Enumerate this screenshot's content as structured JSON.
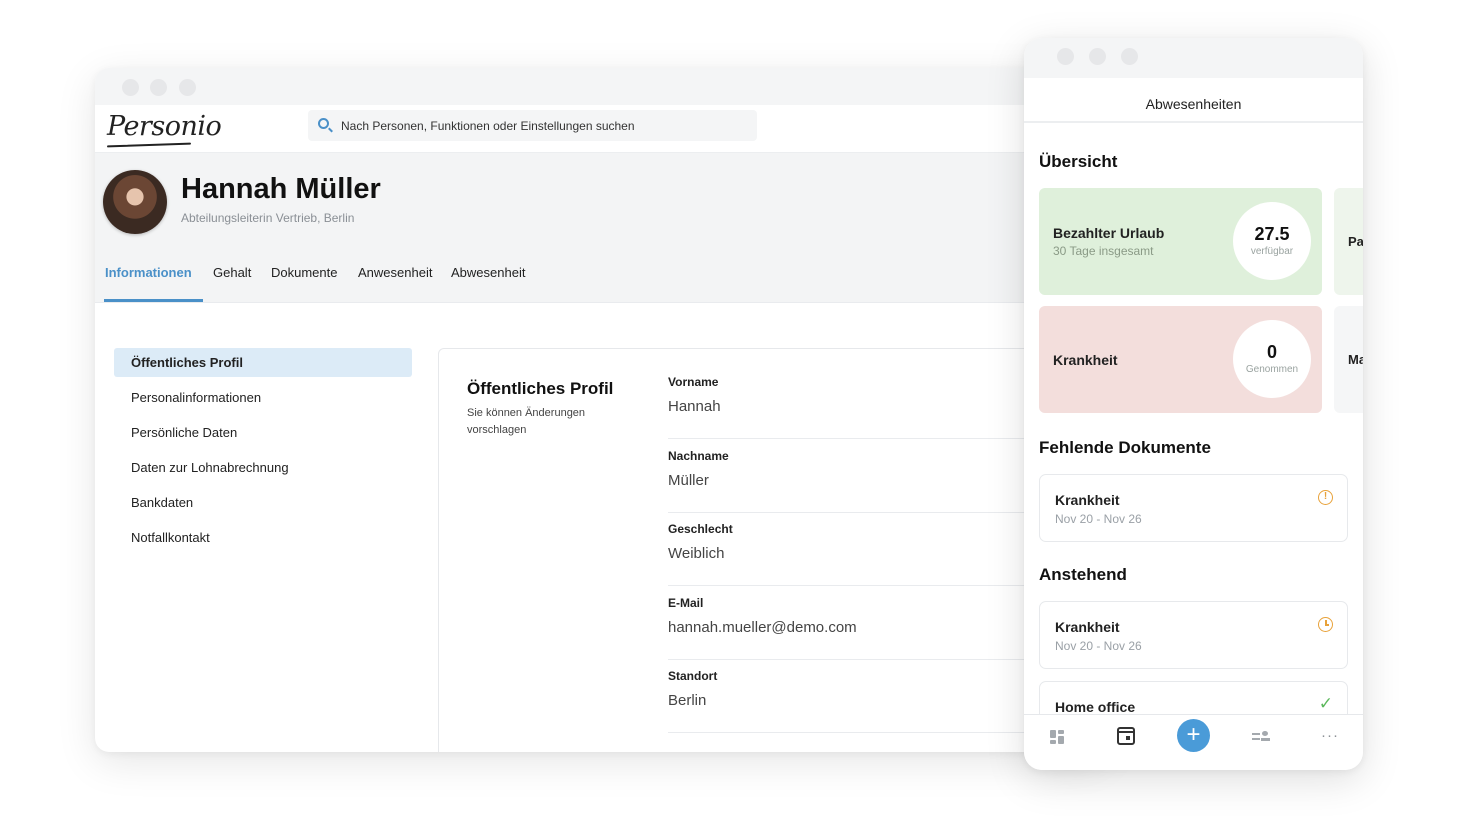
{
  "desktop": {
    "logo": "Personio",
    "search": {
      "placeholder": "Nach Personen, Funktionen oder Einstellungen suchen"
    },
    "profile": {
      "name": "Hannah Müller",
      "subtitle": "Abteilungsleiterin Vertrieb, Berlin"
    },
    "tabs": [
      {
        "label": "Informationen",
        "active": true
      },
      {
        "label": "Gehalt"
      },
      {
        "label": "Dokumente"
      },
      {
        "label": "Anwesenheit"
      },
      {
        "label": "Abwesenheit"
      }
    ],
    "sidebar": [
      {
        "label": "Öffentliches Profil",
        "active": true
      },
      {
        "label": "Personalinformationen"
      },
      {
        "label": "Persönliche Daten"
      },
      {
        "label": "Daten zur Lohnabrechnung"
      },
      {
        "label": "Bankdaten"
      },
      {
        "label": "Notfallkontakt"
      }
    ],
    "card": {
      "title": "Öffentliches Profil",
      "description": "Sie können Änderungen vorschlagen",
      "fields": [
        {
          "label": "Vorname",
          "value": "Hannah"
        },
        {
          "label": "Nachname",
          "value": "Müller"
        },
        {
          "label": "Geschlecht",
          "value": "Weiblich"
        },
        {
          "label": "E-Mail",
          "value": "hannah.mueller@demo.com"
        },
        {
          "label": "Standort",
          "value": "Berlin"
        }
      ]
    }
  },
  "mobile": {
    "title": "Abwesenheiten",
    "overview": {
      "heading": "Übersicht",
      "tiles": [
        {
          "title": "Bezahlter Urlaub",
          "subtitle": "30 Tage insgesamt",
          "value": "27.5",
          "value_label": "verfügbar",
          "peek": "Pa",
          "color": "#dff0db"
        },
        {
          "title": "Krankheit",
          "subtitle": "",
          "value": "0",
          "value_label": "Genommen",
          "peek": "Ma",
          "color": "#f3dedc"
        }
      ]
    },
    "missing_documents": {
      "heading": "Fehlende Dokumente",
      "items": [
        {
          "title": "Krankheit",
          "date": "Nov 20 - Nov 26",
          "icon": "warning-icon"
        }
      ]
    },
    "pending": {
      "heading": "Anstehend",
      "items": [
        {
          "title": "Krankheit",
          "date": "Nov 20 - Nov 26",
          "icon": "clock-icon"
        },
        {
          "title": "Home office",
          "date": "",
          "icon": "check-icon"
        }
      ]
    },
    "bottom_nav": [
      "dashboard-icon",
      "calendar-icon",
      "add-icon",
      "people-list-icon",
      "more-icon"
    ],
    "accent": "#4a9bd8"
  }
}
